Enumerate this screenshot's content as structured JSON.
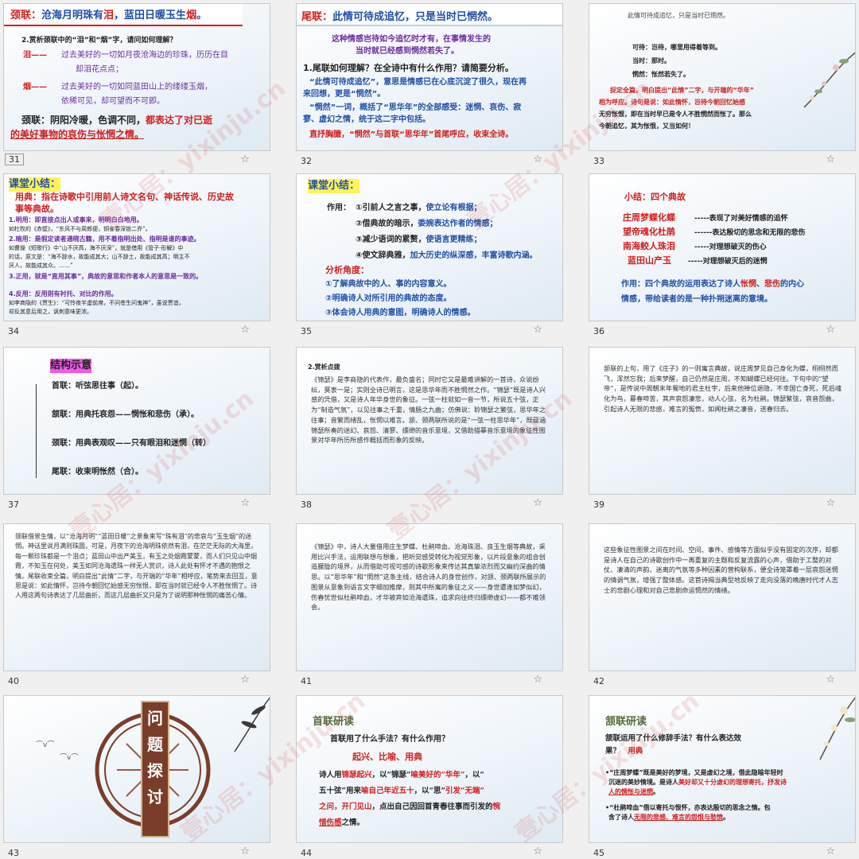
{
  "slides": {
    "s31": {
      "num": "31",
      "title_label": "颈联：",
      "title_text_a": "沧海月明珠有",
      "title_text_tear": "泪",
      "title_text_b": "，蓝田日暖玉生",
      "title_text_smoke": "烟",
      "title_text_end": "。",
      "question": "2.赏析颈联中的“泪”和“烟”字，请问如何理解？",
      "tear_label": "泪——",
      "tear_line1": "过去美好的一切如月夜沧海边的珍珠，历历在目",
      "tear_line2": "却泪花点点；",
      "smoke_label": "烟——",
      "smoke_line1": "过去美好的一切如同蓝田山上的缕缕玉烟，",
      "smoke_line2": "依稀可见，却可望而不可即。",
      "summary_a": "颈联：阴阳冷暖，色调不同，",
      "summary_b": "都表达了对已逝",
      "summary_c": "的美好事物的哀伤与怅惘之情。"
    },
    "s32": {
      "num": "32",
      "title_label": "尾联：",
      "title_text": "此情可待成追忆，只是当时已惘然。",
      "sub1": "这种情感岂待如今追忆时才有，在事情发生的",
      "sub2": "当时就已经感到惘然若失了。",
      "q": "1.尾联如何理解？在全诗中有什么作用？请简要分析。",
      "a1": "“此情可待成追忆”，意思是情感已在心底沉淀了很久，现在再",
      "a2": "来回想，更是“惘然”。",
      "a3": "“惘然”一词，概括了“思华年”的全部感受：迷惘、哀伤、寂",
      "a4": "寥、虚幻之情，统于这二字中包括。",
      "a5": "直抒胸臆，“惘然”与首联“思华年”首尾呼应，收束全诗。"
    },
    "s33": {
      "num": "33",
      "top": "此情可待成追忆，只是当时已惘然。",
      "l1": "可待：岂待，哪里用得着等到。",
      "l2": "当时：那时。",
      "l3": "惘然：怅然若失了。",
      "p1": "捉定全篇，明白提出“此情”二字，与开端的“华年”",
      "p2": "相为呼应。诗句是说：如此情怀，岂待今朝回忆始感",
      "p3": "无穷怅恨，即在当时早已是令人不胜惘然而怅了。那么",
      "p4": "今朝追忆，其为怅恨，又当如何！"
    },
    "s34": {
      "num": "34",
      "heading": "课堂小结：",
      "def1": "用典：指在诗歌中引用前人诗文名句、神话传说、历史故",
      "def2": "事等典故。",
      "m1": "1.明用：即直接点出人或事来，明明白白地用。",
      "m1e": "如杜牧的《赤壁》，“东风不与周郎便，铜雀春深锁二乔”。",
      "m2": "2.暗用：是假定读者通晓古籍，用不着指明出处、指明是谁的事迹。",
      "m2e1": "如曹操《短歌行》中“山不厌高，海不厌深”，就是借用《管子·形解》中",
      "m2e2": "的话，原文是：“海不辞水，故能成其大；山不辞土，故能成其高；明主不",
      "m2e3": "厌人，故能成其众。……”",
      "m3": "3.正用，就是“直用其事”，典故的意思和作者本人的意思是一致的。",
      "m4": "4.反用：反用则有衬托、对比的作用。",
      "m4e1": "如李商隐的《贾生》：“可怜夜半虚前席，不问苍生问鬼神”，虽说贾谊，",
      "m4e2": "却反其意后用之，讽刺意味更浓。"
    },
    "s35": {
      "num": "35",
      "heading": "课堂小结：",
      "label": "作用：",
      "f1a": "①引前人之言之事，",
      "f1b": "使立论有根据；",
      "f2a": "②借典故的暗示，",
      "f2b": "委婉表达作者的情感；",
      "f3a": "③减少语词的累赘，",
      "f3b": "使语言更精练；",
      "f4a": "④使文辞典雅，",
      "f4b": "加大历史的纵深感，丰富诗歌内涵。",
      "angle": "分析角度：",
      "g1": "①了解典故中的人、事的内容意义。",
      "g2": "②明确诗人对所引用的典故的态度。",
      "g3": "③体会诗人用典的意图，明确诗人的情感。"
    },
    "s36": {
      "num": "36",
      "heading": "小结：四个典故",
      "r1a": "庄周梦蝶化蝶",
      "r1b": "-----表现了对美好情感的追怀",
      "r2a": "望帝魂化杜鹃",
      "r2b": "------表达殷切的思念和无限的悲伤",
      "r3a": "南海鲛人珠泪",
      "r3b": "-----对理想破灭的伤心",
      "r4a": "蓝田山产玉",
      "r4b": "-----对理想破灭后的迷惘",
      "e1a": "作用：四个典故的运用表达了诗人",
      "e1b": "怅惘",
      "e1c": "、",
      "e1d": "悲伤",
      "e1e": "的内心",
      "e2": "情感，带给读者的是一种扑朔迷离的意境。"
    },
    "s37": {
      "num": "37",
      "heading": "结构示意",
      "b1": "首联：听弦思往事（起）。",
      "b2": "颔联：用典托哀怨——惘怅和悲伤（承）。",
      "b3": "颈联：用典表观叹——只有眼泪和迷惘（转）",
      "b4": "尾联：收束明怅然（合）。"
    },
    "s38": {
      "num": "38",
      "heading": "2.赏析点拨",
      "body": "《锦瑟》是李商隐的代表作，最负盛名；同时它又是最难讲解的一首诗，众说纷纭，莫衷一是；实则全诗已明言，这是思华年而不胜惘然之作。“锦瑟”既是诗人兴感的凭借，又是诗人年华身世的象征。一弦一柱就如一音一节，所说五十弦，正为“制造气氛”，以见往事之千重，情肠之九曲；仿佛说：聆锦瑟之繁弦，思华年之往事；音繁而绪乱，怅惘以难言。颔、颈两联所说的是“一弦一柱思华年”，既蕴涵锦瑟所奏的迷幻、哀怨、清寥、缥缈的音乐意境，又借助描摹音乐意境的象征性图景对华年所历所感作概括而形象的反映。"
    },
    "s39": {
      "num": "39",
      "body": "颔联的上句，用了《庄子》的一则寓言典故，说庄周梦见自己身化为蝶，栩栩然而飞，浑然忘我；后来梦醒，自己仍然是庄周，不知蝴蝶已经何往。下句中的“望帝”，是传说中周朝末年蜀地的君主杜宇，后来他禅位退隐，不幸国亡身死，死后魂化为鸟，暮春啼苦，其声哀怨凄悲，动人心弦，名为杜鹃。锦瑟繁弦，哀音怨曲，引起诗人无限的悲感，难言的冤愤，如闻杜鹃之凄音，送春归去。"
    },
    "s40": {
      "num": "40",
      "body": "颈联借景生情，以“沧海月明”“蓝田日暖”之景象来写“珠有泪”的悲哀与“玉生烟”的迷惘。神话里说月满则珠圆，可是，月夜下的沧海明珠依然有泪，在茫茫无际的大海里，每一颗珍珠都是一个泪点；蓝田山中出产美玉，有玉之处烟霞蒙蒙，而人们只见山中烟霞，不知玉在何处，美玉如同沧海遗珠一样无人赏识，诗人此处有怀才不遇的抱恨之情。尾联收束全篇，明白提出“此情”二字，与开端的“华年”相呼应，笔势来去回互，意思是说：如此情怀，岂待今朝回忆始感无穷怅恨，即在当时就已经令人不胜怅惘了。诗人用这两句诗表达了几层曲折，而这几层曲折又只是为了说明那种怅惘的痛苦心情。"
    },
    "s41": {
      "num": "41",
      "body": "《锦瑟》中，诗人大量借用庄生梦蝶、杜鹃啼血、沧海珠泪、良玉生烟等典故，采用比兴手法，运用联想与想象，把听觉感受转化为视觉形象，以片段意象的组合创造朦胧的境界，从而借助可视可感的诗歌形象来传达其真挚浓烈而又幽约深曲的情思。以“思华年”和“惘然”这条主线，结合诗人的身世创作，对颔、颈两联所展示的图景从意象到语言文字细加推摩，则其中所寓的象征之义——身世遭逢如梦似幻，伤春忧世似杜鹃啼血，才华被弃如沧海遗珠，追求向往终归缥缈虚幻——都不难领会。"
    },
    "s42": {
      "num": "42",
      "body": "这些象征性图景之间在时间、空间、事件、感情等方面似乎没有固定的次序，却都是诗人在自己的诗歌创作中一再重复的主题和反复流露的心声，借助于工整的对仗、凄清的声韵、迷离的气氛等多种因素的营构联系，便全诗笼罩着一层哀怨迷惘的情调气氛，增强了整体感。这首诗揭当典型地反映了走向没落的晚唐时代才人志士的悲剧心理和对自己悲剧命运惘然的情绪。"
    },
    "s43": {
      "num": "43",
      "c1": "问",
      "c2": "题",
      "c3": "探",
      "c4": "讨"
    },
    "s44": {
      "num": "44",
      "heading": "首联研读",
      "q": "首联用了什么手法？有什么作用？",
      "a": "起兴、比喻、用典",
      "p1a": "诗人用",
      "p1b": "锦瑟起兴",
      "p1c": "，以“锦瑟”",
      "p1d": "喻美好的“华年”",
      "p1e": "，以“",
      "p2a": "五十弦”用来",
      "p2b": "喻自己年近五十",
      "p2c": "，以“思”",
      "p2d": "引发“无端”",
      "p3a": "之问，开门见山",
      "p3b": "，点出自己因回首青春往事而引发的",
      "p3c": "惋",
      "p4a": "惜伤感",
      "p4b": "之情。"
    },
    "s45": {
      "num": "45",
      "heading": "颔联研读",
      "q1": "颔联运用了什么修辞手法？有什么表达效",
      "q2": "果？",
      "a": "用典",
      "b1a": "•“庄周梦蝶”既是美好的梦境，又是虚幻之境，借此隐喻年轻时",
      "b1b": "沉迷的美妙情境。是诗人",
      "b1c": "美好却又十分虚幻的理想寄托，抒发诗",
      "b1d": "人的惆怅与迷惘",
      "b1e": "。",
      "b2a": "•“杜鹃啼血”借以寄托与恨怀，亦表达殷切的思念之情。包",
      "b2b": "含了诗人",
      "b2c": "无限的悲感、难言的怨恨与愁愤",
      "b2d": "。"
    }
  },
  "watermark": "壹心居：yixinju.cn",
  "watermark_short": "yixinju.cn",
  "colors": {
    "blue": "#1f4fa8",
    "red": "#d21e1e",
    "purple": "#6d2da0"
  },
  "icons": {
    "star": "star-icon"
  }
}
